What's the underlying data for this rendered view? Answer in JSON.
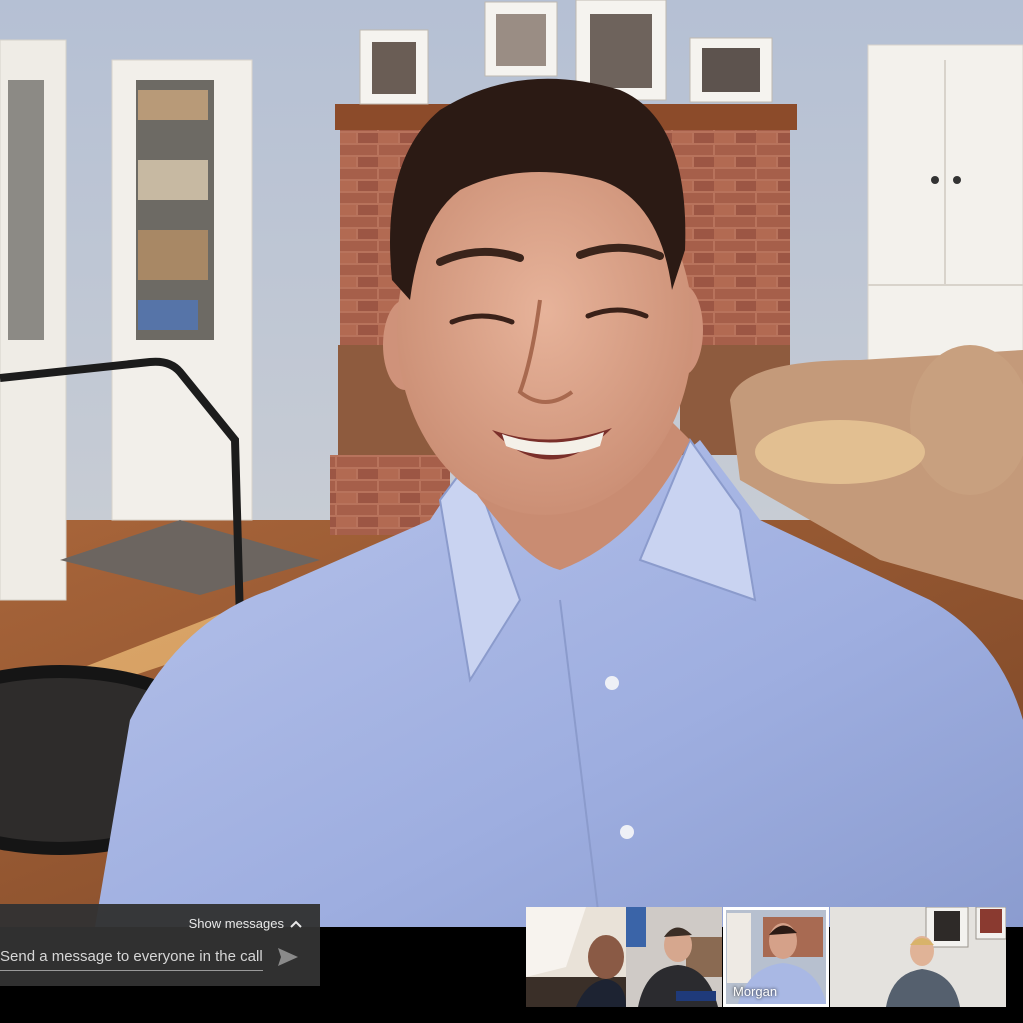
{
  "chat": {
    "toggle_label": "Show messages",
    "input_placeholder": "Send a message to everyone in the call",
    "toggle_icon": "chevron-up-icon",
    "send_icon": "send-icon"
  },
  "main_video": {
    "subject": "Smiling man in light blue dress shirt in living room"
  },
  "participants": [
    {
      "name": "",
      "active": false
    },
    {
      "name": "",
      "active": false
    },
    {
      "name": "Morgan",
      "active": true
    },
    {
      "name": "",
      "active": false
    }
  ],
  "colors": {
    "chat_bg": "#323232",
    "active_outline": "#ffffff",
    "shirt": "#a9b8e4",
    "wall": "#b8c4d6"
  }
}
